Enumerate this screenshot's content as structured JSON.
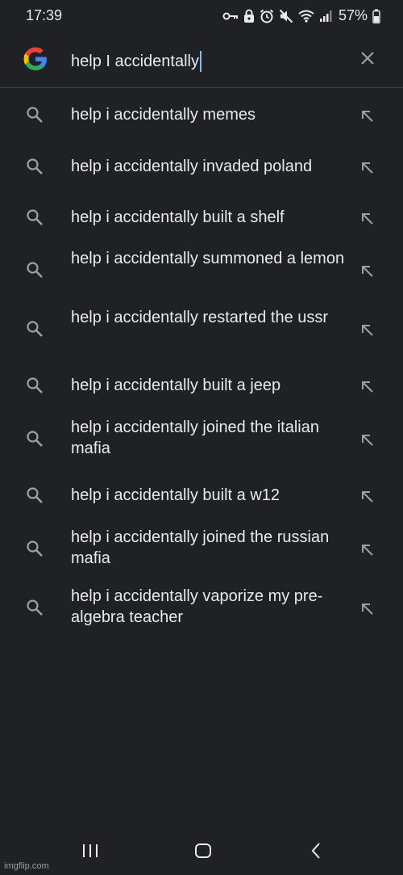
{
  "status_bar": {
    "time": "17:39",
    "battery_percent": "57%",
    "icons": [
      "vpn-key-icon",
      "lock-icon",
      "alarm-icon",
      "mute-icon",
      "wifi-icon",
      "signal-icon",
      "battery-icon"
    ]
  },
  "search": {
    "query": "help I accidentally",
    "clear_icon": "close-icon"
  },
  "suggestions": [
    "help i accidentally memes",
    "help i accidentally invaded poland",
    "help i accidentally built a shelf",
    "help i accidentally summoned a lemon",
    "help i accidentally restarted the ussr",
    "help i accidentally built a jeep",
    "help i accidentally joined the italian mafia",
    "help i accidentally built a w12",
    "help i accidentally joined the russian mafia",
    "help i accidentally vaporize my pre-algebra teacher"
  ],
  "nav_bar": {
    "icons": [
      "recent-apps-icon",
      "home-icon",
      "back-icon"
    ]
  },
  "watermark": "imgflip.com",
  "colors": {
    "background": "#202124",
    "text": "#e8eaed",
    "icon": "#9aa0a6",
    "caret": "#8ab4f8"
  }
}
